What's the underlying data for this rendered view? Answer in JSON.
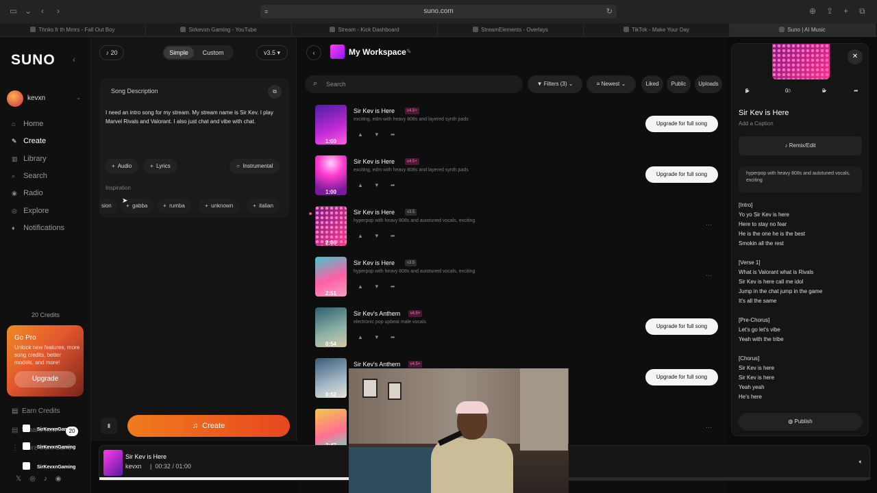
{
  "browser": {
    "url": "suno.com",
    "tabs": [
      {
        "label": "Thnks fr th Mmrs - Fall Out Boy",
        "active": false
      },
      {
        "label": "Sirkevxn Gaming - YouTube",
        "active": false
      },
      {
        "label": "Stream - Kick Dashboard",
        "active": false
      },
      {
        "label": "StreamElements - Overlays",
        "active": false
      },
      {
        "label": "TikTok - Make Your Day",
        "active": false
      },
      {
        "label": "Suno | AI Music",
        "active": true
      }
    ]
  },
  "sidebar": {
    "logo": "SUNO",
    "user": "kevxn",
    "nav": [
      {
        "label": "Home",
        "icon": "home-icon",
        "active": false
      },
      {
        "label": "Create",
        "icon": "create-icon",
        "active": true
      },
      {
        "label": "Library",
        "icon": "library-icon",
        "active": false
      },
      {
        "label": "Search",
        "icon": "search-icon",
        "active": false
      },
      {
        "label": "Radio",
        "icon": "radio-icon",
        "active": false
      },
      {
        "label": "Explore",
        "icon": "explore-icon",
        "active": false
      },
      {
        "label": "Notifications",
        "icon": "bell-icon",
        "active": false
      }
    ],
    "credits": "20 Credits",
    "gopro": {
      "title": "Go Pro",
      "desc": "Unlock new features, more song credits, better models, and more!",
      "button": "Upgrade"
    },
    "earn_credits": "Earn Credits",
    "whats_new": "What's new?",
    "more_from_suno": "More from Suno",
    "whats_new_badge": "20",
    "overlay_handles": [
      "SirKevxnGaming",
      "SirKevxnGaming",
      "SirKevxnGaming"
    ]
  },
  "create": {
    "credits": "20",
    "mode_simple": "Simple",
    "mode_custom": "Custom",
    "version": "v3.5",
    "song_description_label": "Song Description",
    "song_description": "I need an intro song for my stream. My stream name is Sir Kev. I play Marvel Rivals and Valorant. I also just chat and vibe with chat.",
    "audio_btn": "Audio",
    "lyrics_btn": "Lyrics",
    "instrumental_btn": "Instrumental",
    "inspiration_label": "Inspiration",
    "tags": [
      "sion",
      "gabba",
      "rumba",
      "unknown",
      "italian"
    ],
    "create_btn": "Create"
  },
  "workspace": {
    "title": "My Workspace",
    "search_placeholder": "Search",
    "filters": "Filters (3)",
    "sort": "Newest",
    "liked": "Liked",
    "public": "Public",
    "uploads": "Uploads",
    "upgrade_label": "Upgrade for full song",
    "songs": [
      {
        "title": "Sir Kev is Here",
        "version": "v4.5+",
        "desc": "exciting, edm with heavy 808s and layered synth pads",
        "duration": "1:00",
        "upgrade": true
      },
      {
        "title": "Sir Kev is Here",
        "version": "v4.5+",
        "desc": "exciting, edm with heavy 808s and layered synth pads",
        "duration": "1:00",
        "upgrade": true
      },
      {
        "title": "Sir Kev is Here",
        "version": "v3.5",
        "desc": "hyperpop with heavy 808s and autotuned vocals, exciting",
        "duration": "2:06",
        "upgrade": false
      },
      {
        "title": "Sir Kev is Here",
        "version": "v3.5",
        "desc": "hyperpop with heavy 808s and autotuned vocals, exciting",
        "duration": "2:51",
        "upgrade": false
      },
      {
        "title": "Sir Kev's Anthem",
        "version": "v4.5+",
        "desc": "electronic pop upbeat male vocals",
        "duration": "0:54",
        "upgrade": true
      },
      {
        "title": "Sir Kev's Anthem",
        "version": "v4.5+",
        "desc": "",
        "duration": "0:52",
        "upgrade": true
      },
      {
        "title": "",
        "version": "",
        "desc": "",
        "duration": "2:47",
        "upgrade": false
      }
    ]
  },
  "detail": {
    "plays": "2",
    "likes": "0",
    "comments": "0",
    "title": "Sir Kev is Here",
    "caption": "Add a Caption",
    "remix": "Remix/Edit",
    "style": "hyperpop with heavy 808s and autotuned vocals, exciting",
    "lyrics": "[Intro]\nYo yo Sir Kev is here\nHere to stay no fear\nHe is the one he is the best\nSmokin all the rest\n\n[Verse 1]\nWhat is Valorant what is Rivals\nSir Kev is here call me idol\nJump in the chat jump in the game\nIt's all the same\n\n[Pre-Chorus]\nLet's go let's vibe\nYeah with the tribe\n\n[Chorus]\nSir Kev is here\nSir Kev is here\nYeah yeah\nHe's here",
    "publish": "Publish"
  },
  "player": {
    "title": "Sir Kev is Here",
    "artist": "kevxn",
    "current": "00:32",
    "total": "01:00",
    "progress": 0.53
  }
}
